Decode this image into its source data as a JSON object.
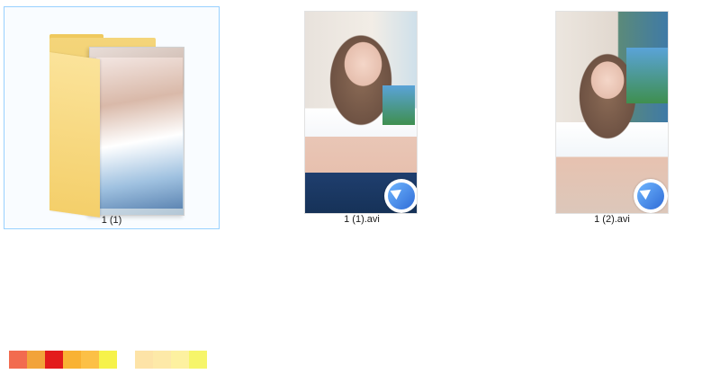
{
  "explorer": {
    "items": [
      {
        "name": "1 (1)",
        "type": "folder",
        "selected": true,
        "icon": "folder-icon"
      },
      {
        "name": "1 (1).avi",
        "type": "video",
        "selected": false,
        "icon": "video-thumbnail",
        "badge": "media-player-icon"
      },
      {
        "name": "1 (2).avi",
        "type": "video",
        "selected": false,
        "icon": "video-thumbnail",
        "badge": "media-player-icon"
      }
    ]
  },
  "colors": {
    "selection_border": "#99d1ff",
    "folder_yellow": "#f4cf6a",
    "badge_blue": "#2f6bd6",
    "swatches": [
      "#f26b4f",
      "#f2a33a",
      "#e31b1b",
      "#f9b233",
      "#fcc046",
      "#f6f24a",
      "#fde3a7",
      "#fde9a8",
      "#fdf1a0",
      "#f6f56a"
    ]
  }
}
